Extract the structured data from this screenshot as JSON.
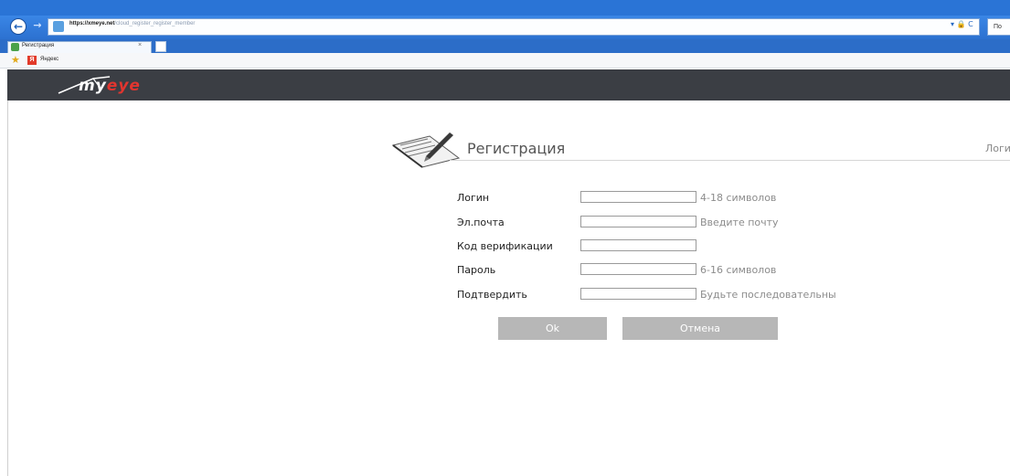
{
  "browser": {
    "url_host": "https://xmeye.net",
    "url_path": "/cloud_register_register_member",
    "search_stub": "По",
    "tab_title": "Регистрация",
    "tab_close": "×",
    "favorites_label": "Яндекс",
    "favorites_badge": "Я",
    "back_glyph": "←",
    "forward_glyph": "→",
    "addr_icons": "▾ 🔒 C",
    "icons": {
      "back": "arrow-left-icon",
      "forward": "arrow-right-icon",
      "favorites": "star-icon",
      "yandex": "yandex-icon",
      "tab_favicon": "ie-page-icon"
    }
  },
  "site": {
    "logo_main": "myeye",
    "logo_part1": "my",
    "logo_part2": "eye",
    "header_color": "#3b3e44",
    "accent_color": "#e2352f"
  },
  "registration": {
    "title": "Регистрация",
    "login_link": "Логин",
    "icon": "pen-paper-icon",
    "fields": [
      {
        "label": "Логин",
        "value": "",
        "hint": "4-18 символов"
      },
      {
        "label": "Эл.почта",
        "value": "",
        "hint": "Введите почту"
      },
      {
        "label": "Код верификации",
        "value": "",
        "hint": ""
      },
      {
        "label": "Пароль",
        "value": "",
        "hint": "6-16 символов"
      },
      {
        "label": "Подтвердить",
        "value": "",
        "hint": "Будьте последовательны"
      }
    ],
    "ok_label": "Ok",
    "cancel_label": "Отмена",
    "button_color": "#b7b7b7"
  }
}
